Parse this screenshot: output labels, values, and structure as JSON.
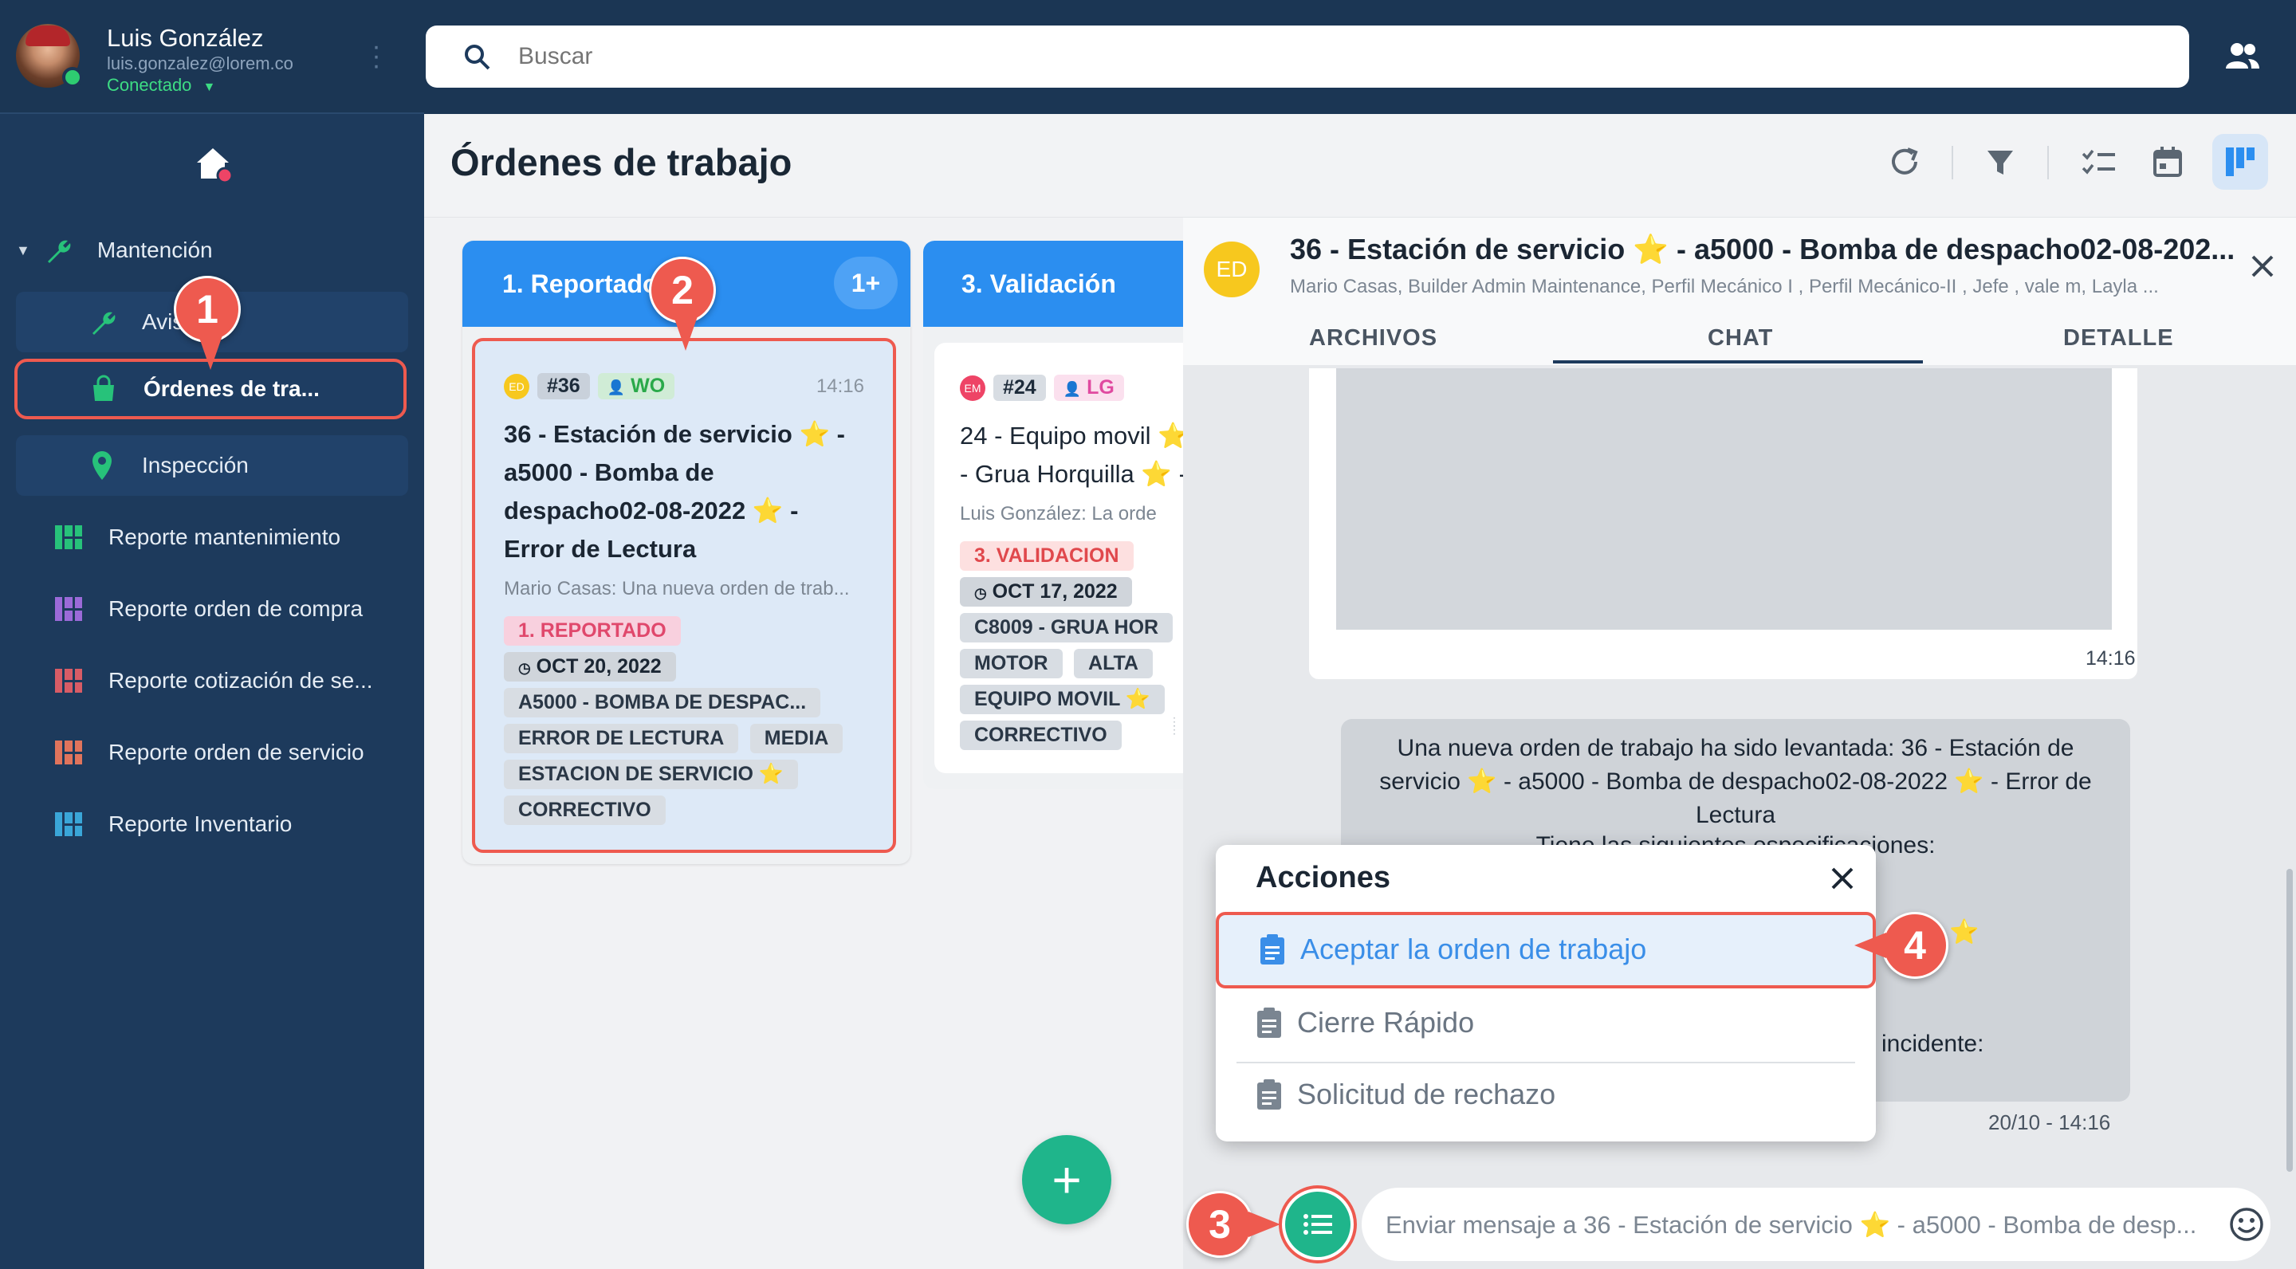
{
  "user": {
    "name": "Luis González",
    "email": "luis.gonzalez@lorem.co",
    "status": "Conectado"
  },
  "search": {
    "placeholder": "Buscar"
  },
  "sidebar": {
    "group": "Mantención",
    "sub_items": [
      "Avis",
      "Órdenes de tra...",
      "Inspección"
    ],
    "items": [
      "Reporte mantenimiento",
      "Reporte orden de compra",
      "Reporte cotización de se...",
      "Reporte orden de servicio",
      "Reporte Inventario"
    ]
  },
  "page": {
    "title": "Órdenes de trabajo"
  },
  "columns": [
    {
      "title": "1. Reportado",
      "count": "1+"
    },
    {
      "title": "3. Validación"
    }
  ],
  "card1": {
    "avatar": "ED",
    "id": "#36",
    "who": "WO",
    "time": "14:16",
    "title": "36 - Estación de servicio ⭐ - a5000 - Bomba de despacho02-08-2022 ⭐ - Error de Lectura",
    "preview": "Mario Casas: Una nueva orden de trab...",
    "state": "1. REPORTADO",
    "date": "OCT 20, 2022",
    "tags": [
      "A5000 - BOMBA DE DESPAC...",
      "ERROR DE LECTURA",
      "MEDIA",
      "ESTACION DE SERVICIO ⭐",
      "CORRECTIVO"
    ]
  },
  "card2": {
    "avatar": "EM",
    "id": "#24",
    "who": "LG",
    "title": "24 - Equipo movil ⭐ - Grua Horquilla ⭐ -",
    "preview": "Luis González: La orde",
    "state": "3. VALIDACION",
    "date": "OCT 17, 2022",
    "tags": [
      "C8009 - GRUA HOR",
      "MOTOR",
      "ALTA",
      "EQUIPO MOVIL ⭐",
      "CORRECTIVO"
    ]
  },
  "chat": {
    "avatar": "ED",
    "title": "36 - Estación de servicio ⭐ - a5000 - Bomba de despacho02-08-202...",
    "participants": "Mario Casas, Builder Admin Maintenance, Perfil Mecánico I , Perfil Mecánico-II , Jefe , vale m, Layla ...",
    "tabs": [
      "ARCHIVOS",
      "CHAT",
      "DETALLE"
    ],
    "msg1_time": "14:16",
    "msg2_text": "Una nueva orden de trabajo ha sido levantada: 36 - Estación de servicio ⭐ - a5000 - Bomba de despacho02-08-2022 ⭐ - Error de Lectura",
    "msg2_line2": "Tiene las siguientes especificaciones:",
    "msg2_frag1": "2 ⭐",
    "msg2_frag2": "incidente:",
    "msg2_time": "20/10 - 14:16",
    "input_placeholder": "Enviar mensaje a 36 - Estación de servicio ⭐ - a5000 - Bomba de desp..."
  },
  "actions": {
    "title": "Acciones",
    "items": [
      "Aceptar la orden de trabajo",
      "Cierre Rápido",
      "Solicitud de rechazo"
    ]
  },
  "markers": [
    "1",
    "2",
    "3",
    "4"
  ],
  "colors": {
    "sidebar": "#1d3a5c",
    "accent": "#2b8ef0",
    "highlight": "#ee5a4f",
    "fab": "#1fb58b",
    "online": "#2ecc71"
  }
}
